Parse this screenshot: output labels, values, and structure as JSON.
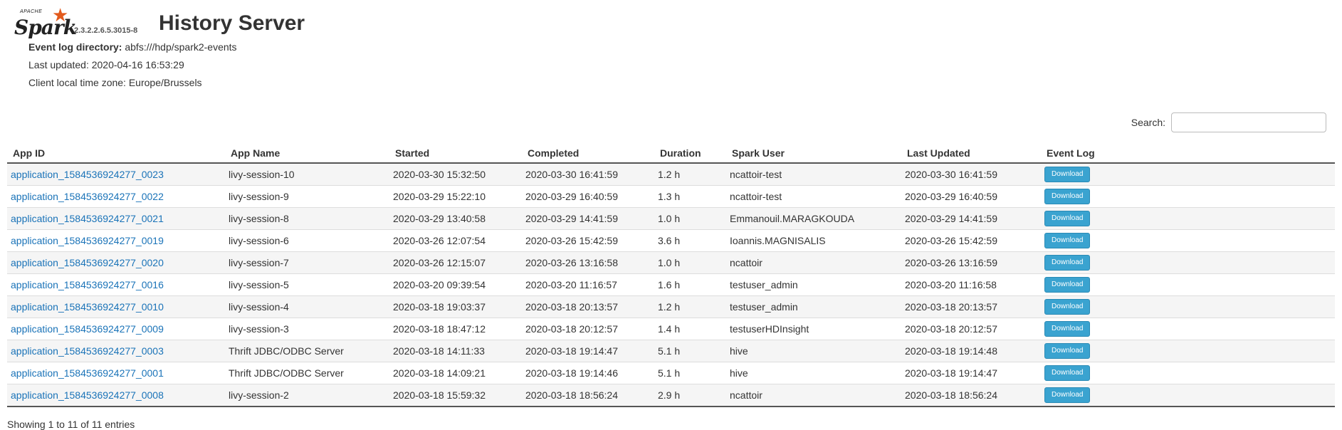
{
  "header": {
    "logo_text": "Spark",
    "logo_apache": "APACHE",
    "version": "2.3.2.2.6.5.3015-8",
    "title": "History Server"
  },
  "info": {
    "event_log_label": "Event log directory:",
    "event_log_value": "abfs:///hdp/spark2-events",
    "last_updated": "Last updated: 2020-04-16 16:53:29",
    "timezone": "Client local time zone: Europe/Brussels"
  },
  "search": {
    "label": "Search:",
    "value": ""
  },
  "table": {
    "headers": [
      "App ID",
      "App Name",
      "Started",
      "Completed",
      "Duration",
      "Spark User",
      "Last Updated",
      "Event Log"
    ],
    "download_label": "Download",
    "rows": [
      {
        "id": "application_1584536924277_0023",
        "name": "livy-session-10",
        "started": "2020-03-30 15:32:50",
        "completed": "2020-03-30 16:41:59",
        "duration": "1.2 h",
        "user": "ncattoir-test",
        "updated": "2020-03-30 16:41:59"
      },
      {
        "id": "application_1584536924277_0022",
        "name": "livy-session-9",
        "started": "2020-03-29 15:22:10",
        "completed": "2020-03-29 16:40:59",
        "duration": "1.3 h",
        "user": "ncattoir-test",
        "updated": "2020-03-29 16:40:59"
      },
      {
        "id": "application_1584536924277_0021",
        "name": "livy-session-8",
        "started": "2020-03-29 13:40:58",
        "completed": "2020-03-29 14:41:59",
        "duration": "1.0 h",
        "user": "Emmanouil.MARAGKOUDA",
        "updated": "2020-03-29 14:41:59"
      },
      {
        "id": "application_1584536924277_0019",
        "name": "livy-session-6",
        "started": "2020-03-26 12:07:54",
        "completed": "2020-03-26 15:42:59",
        "duration": "3.6 h",
        "user": "Ioannis.MAGNISALIS",
        "updated": "2020-03-26 15:42:59"
      },
      {
        "id": "application_1584536924277_0020",
        "name": "livy-session-7",
        "started": "2020-03-26 12:15:07",
        "completed": "2020-03-26 13:16:58",
        "duration": "1.0 h",
        "user": "ncattoir",
        "updated": "2020-03-26 13:16:59"
      },
      {
        "id": "application_1584536924277_0016",
        "name": "livy-session-5",
        "started": "2020-03-20 09:39:54",
        "completed": "2020-03-20 11:16:57",
        "duration": "1.6 h",
        "user": "testuser_admin",
        "updated": "2020-03-20 11:16:58"
      },
      {
        "id": "application_1584536924277_0010",
        "name": "livy-session-4",
        "started": "2020-03-18 19:03:37",
        "completed": "2020-03-18 20:13:57",
        "duration": "1.2 h",
        "user": "testuser_admin",
        "updated": "2020-03-18 20:13:57"
      },
      {
        "id": "application_1584536924277_0009",
        "name": "livy-session-3",
        "started": "2020-03-18 18:47:12",
        "completed": "2020-03-18 20:12:57",
        "duration": "1.4 h",
        "user": "testuserHDInsight",
        "updated": "2020-03-18 20:12:57"
      },
      {
        "id": "application_1584536924277_0003",
        "name": "Thrift JDBC/ODBC Server",
        "started": "2020-03-18 14:11:33",
        "completed": "2020-03-18 19:14:47",
        "duration": "5.1 h",
        "user": "hive",
        "updated": "2020-03-18 19:14:48"
      },
      {
        "id": "application_1584536924277_0001",
        "name": "Thrift JDBC/ODBC Server",
        "started": "2020-03-18 14:09:21",
        "completed": "2020-03-18 19:14:46",
        "duration": "5.1 h",
        "user": "hive",
        "updated": "2020-03-18 19:14:47"
      },
      {
        "id": "application_1584536924277_0008",
        "name": "livy-session-2",
        "started": "2020-03-18 15:59:32",
        "completed": "2020-03-18 18:56:24",
        "duration": "2.9 h",
        "user": "ncattoir",
        "updated": "2020-03-18 18:56:24"
      }
    ]
  },
  "footer": {
    "entries_text": "Showing 1 to 11 of 11 entries"
  },
  "colors": {
    "link": "#1a73b8",
    "download_button": "#3aa3d0",
    "logo_star": "#e25a1c"
  }
}
